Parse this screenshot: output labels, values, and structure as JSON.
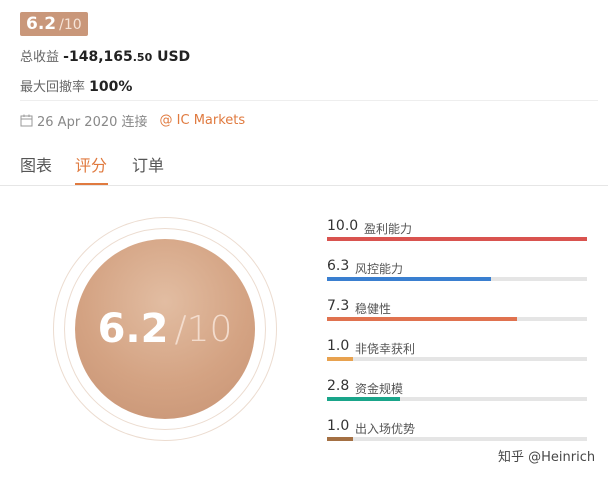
{
  "summary": {
    "score_badge_value": "6.2",
    "score_badge_max": "/10",
    "profit_label": "总收益",
    "profit_value": "-148,165",
    "profit_cents": ".50",
    "profit_currency": "USD",
    "drawdown_label": "最大回撤率",
    "drawdown_value": "100%",
    "connect_date": "26 Apr 2020 连接",
    "broker": "@ IC Markets"
  },
  "tabs": [
    {
      "label": "图表",
      "active": false
    },
    {
      "label": "评分",
      "active": true
    },
    {
      "label": "订单",
      "active": false
    }
  ],
  "rating": {
    "score": "6.2",
    "max": "/10",
    "metrics": [
      {
        "value": "10.0",
        "label": "盈利能力",
        "fraction": 1.0,
        "color": "#d9534f"
      },
      {
        "value": "6.3",
        "label": "风控能力",
        "fraction": 0.63,
        "color": "#3a7fd0"
      },
      {
        "value": "7.3",
        "label": "稳健性",
        "fraction": 0.73,
        "color": "#e0724f"
      },
      {
        "value": "1.0",
        "label": "非侥幸获利",
        "fraction": 0.1,
        "color": "#e8a24f"
      },
      {
        "value": "2.8",
        "label": "资金规模",
        "fraction": 0.28,
        "color": "#1aa58a"
      },
      {
        "value": "1.0",
        "label": "出入场优势",
        "fraction": 0.1,
        "color": "#a47043"
      }
    ]
  },
  "watermark": "知乎 @Heinrich"
}
